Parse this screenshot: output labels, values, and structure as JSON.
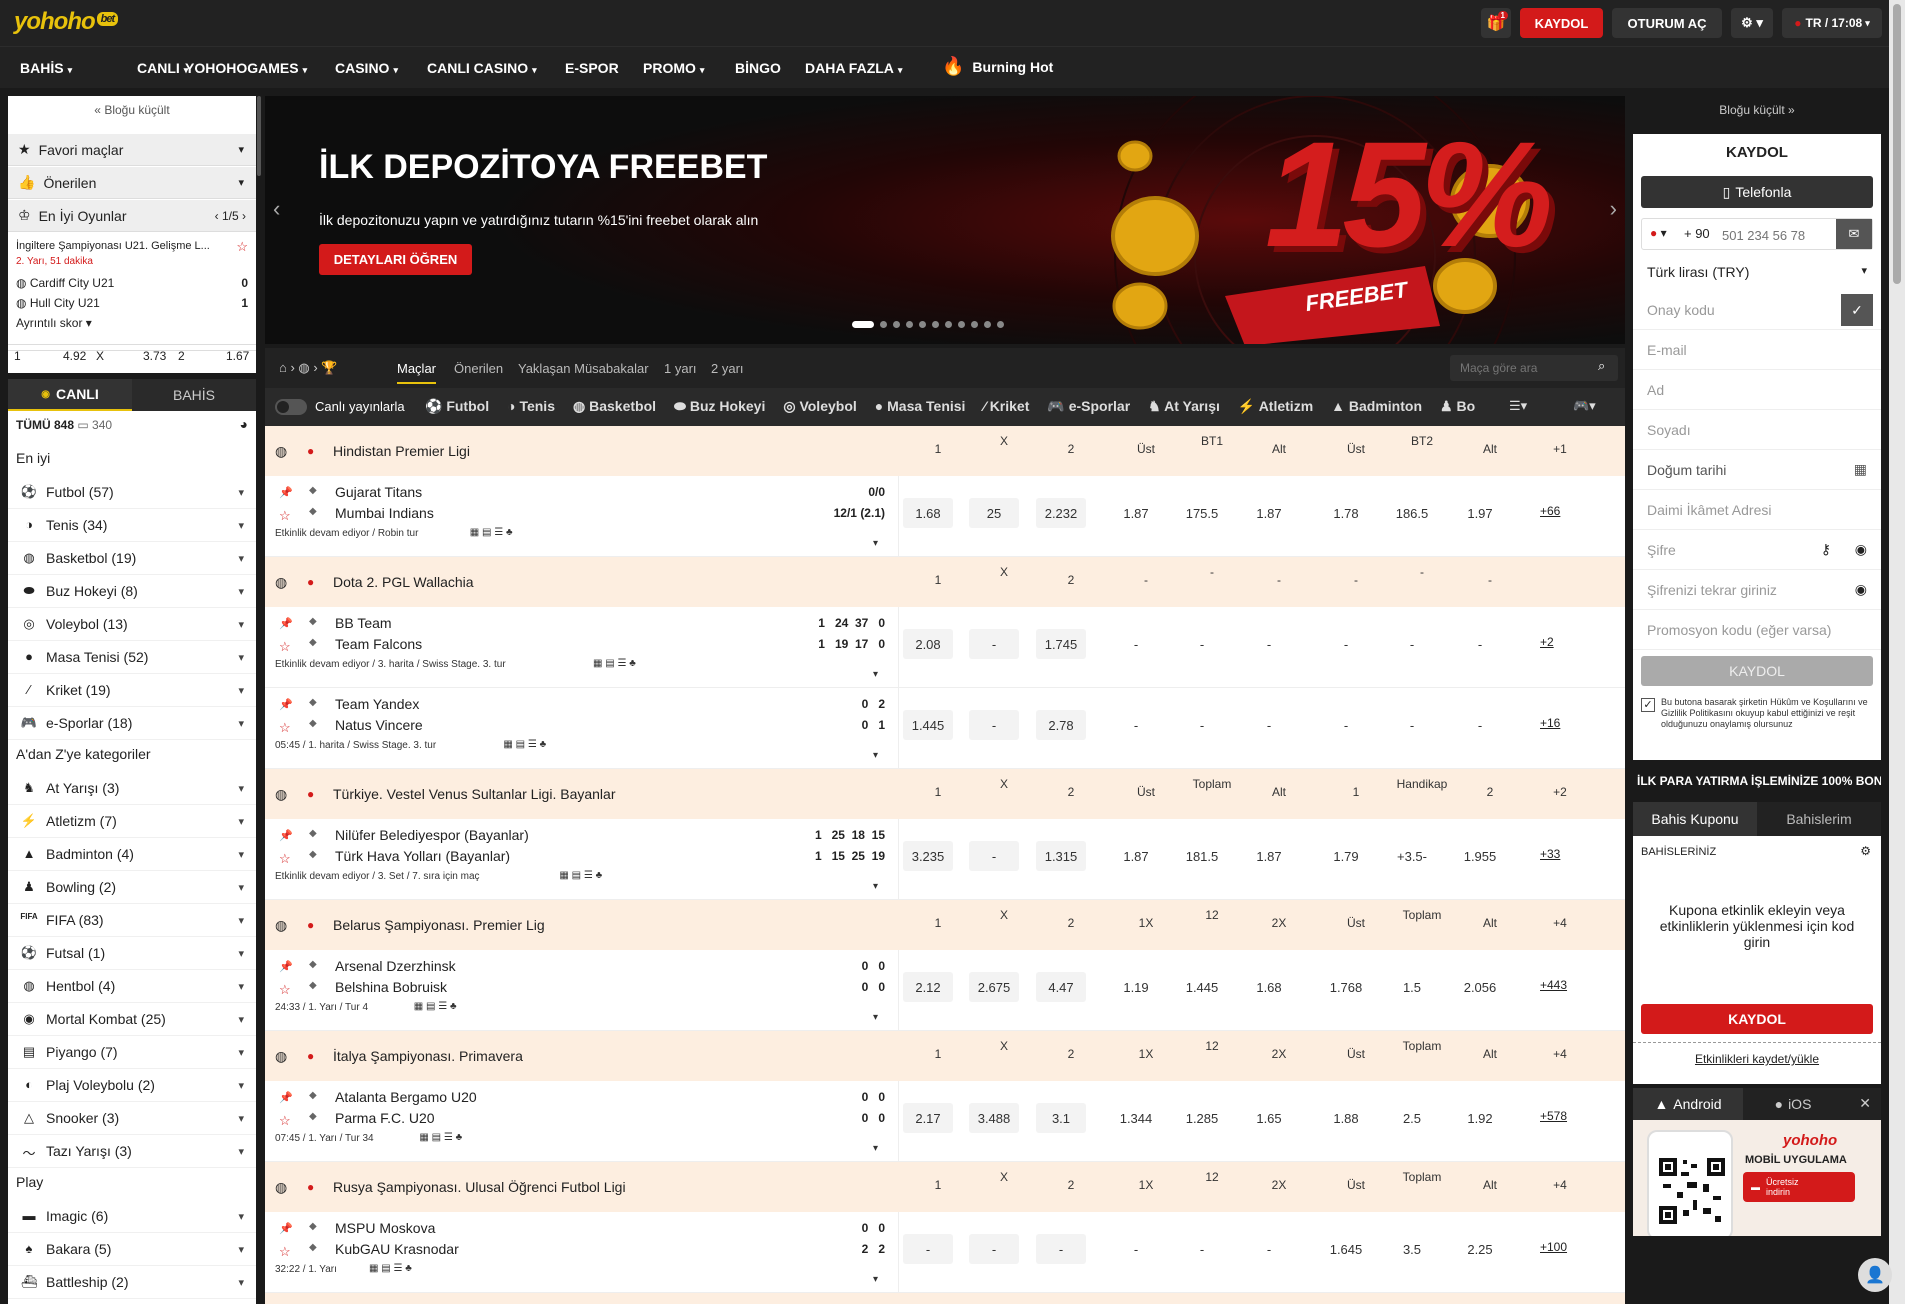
{
  "header": {
    "logo": "yohoho",
    "logo_badge": "bet",
    "gift_count": "1",
    "register": "KAYDOL",
    "login": "OTURUM AÇ",
    "lang_time": "TR / 17:08"
  },
  "nav": [
    "BAHİS",
    "CANLI",
    "YOHOHOGAMES",
    "CASINO",
    "CANLI CASINO",
    "E-SPOR",
    "PROMO",
    "BİNGO",
    "DAHA FAZLA"
  ],
  "nav_special": "Burning Hot",
  "left": {
    "collapse": "Bloğu küçült",
    "favorites": "Favori maçlar",
    "recommended": "Önerilen",
    "top_games": "En İyi Oyunlar",
    "top_pager": "1/5",
    "top_match": {
      "league": "İngiltere Şampiyonası U21. Gelişme L...",
      "status": "2. Yarı, 51 dakika",
      "team1": "Cardiff City U21",
      "score1": "0",
      "team2": "Hull City U21",
      "score2": "1",
      "detail": "Ayrıntılı skor",
      "odds": [
        "1",
        "4.92",
        "X",
        "3.73",
        "2",
        "1.67"
      ]
    },
    "tab_live": "CANLI",
    "tab_bet": "BAHİS",
    "all_label": "TÜMÜ 848",
    "all_count": "340",
    "best": "En iyi",
    "sports": [
      "Futbol (57)",
      "Tenis (34)",
      "Basketbol (19)",
      "Buz Hokeyi (8)",
      "Voleybol (13)",
      "Masa Tenisi (52)",
      "Kriket (19)",
      "e-Sporlar (18)"
    ],
    "az": "A'dan Z'ye kategoriler",
    "az_items": [
      "At Yarışı (3)",
      "Atletizm (7)",
      "Badminton (4)",
      "Bowling (2)",
      "FIFA (83)",
      "Futsal (1)",
      "Hentbol (4)",
      "Mortal Kombat (25)",
      "Piyango (7)",
      "Plaj Voleybolu (2)",
      "Snooker (3)",
      "Tazı Yarışı (3)"
    ],
    "play": "Play",
    "play_items": [
      "Imagic (6)",
      "Bakara (5)",
      "Battleship (2)"
    ]
  },
  "banner": {
    "title": "İLK DEPOZİTOYA FREEBET",
    "subtitle": "İlk depozitonuzu yapın ve yatırdığınız tutarın %15'ini freebet olarak alın",
    "cta": "DETAYLARI ÖĞREN",
    "big": "15%",
    "ribbon": "FREEBET"
  },
  "tabs": [
    "Maçlar",
    "Önerilen",
    "Yaklaşan Müsabakalar",
    "1 yarı",
    "2 yarı"
  ],
  "search_placeholder": "Maça göre ara",
  "live_toggle": "Canlı yayınlarla",
  "sport_tabs": [
    "Futbol",
    "Tenis",
    "Basketbol",
    "Buz Hokeyi",
    "Voleybol",
    "Masa Tenisi",
    "Kriket",
    "e-Sporlar",
    "At Yarışı",
    "Atletizm",
    "Badminton",
    "Bo"
  ],
  "leagues": [
    {
      "name": "Hindistan Premier Ligi",
      "h": [
        "1",
        "X",
        "2",
        "Üst",
        "BT1",
        "Alt",
        "Üst",
        "BT2",
        "Alt",
        "+1"
      ],
      "events": [
        {
          "t1": "Gujarat Titans",
          "t2": "Mumbai Indians",
          "s1": "0/0",
          "s2": "12/1 (2.1)",
          "info": "Etkinlik devam ediyor / Robin tur",
          "odds": [
            "1.68",
            "25",
            "2.232",
            "1.87",
            "175.5",
            "1.87",
            "1.78",
            "186.5",
            "1.97"
          ],
          "more": "+66"
        }
      ]
    },
    {
      "name": "Dota 2. PGL Wallachia",
      "h": [
        "1",
        "X",
        "2",
        "-",
        "-",
        "-",
        "-",
        "-",
        "-",
        ""
      ],
      "events": [
        {
          "t1": "BB Team",
          "t2": "Team Falcons",
          "s1": "1   24  37   0",
          "s2": "1   19  17   0",
          "info": "Etkinlik devam ediyor / 3. harita / Swiss Stage. 3. tur",
          "odds": [
            "2.08",
            "-",
            "1.745",
            "-",
            "-",
            "-",
            "-",
            "-",
            "-"
          ],
          "more": "+2"
        },
        {
          "t1": "Team Yandex",
          "t2": "Natus Vincere",
          "s1": "0   2",
          "s2": "0   1",
          "info": "05:45 / 1. harita / Swiss Stage. 3. tur",
          "odds": [
            "1.445",
            "-",
            "2.78",
            "-",
            "-",
            "-",
            "-",
            "-",
            "-"
          ],
          "more": "+16"
        }
      ]
    },
    {
      "name": "Türkiye. Vestel Venus Sultanlar Ligi. Bayanlar",
      "h": [
        "1",
        "X",
        "2",
        "Üst",
        "Toplam",
        "Alt",
        "1",
        "Handikap",
        "2",
        "+2"
      ],
      "events": [
        {
          "t1": "Nilüfer Belediyespor (Bayanlar)",
          "t2": "Türk Hava Yolları (Bayanlar)",
          "s1": "1   25  18  15",
          "s2": "1   15  25  19",
          "info": "Etkinlik devam ediyor / 3. Set / 7. sıra için maç",
          "odds": [
            "3.235",
            "-",
            "1.315",
            "1.87",
            "181.5",
            "1.87",
            "1.79",
            "+3.5-",
            "1.955"
          ],
          "more": "+33"
        }
      ]
    },
    {
      "name": "Belarus Şampiyonası. Premier Lig",
      "h": [
        "1",
        "X",
        "2",
        "1X",
        "12",
        "2X",
        "Üst",
        "Toplam",
        "Alt",
        "+4"
      ],
      "events": [
        {
          "t1": "Arsenal Dzerzhinsk",
          "t2": "Belshina Bobruisk",
          "s1": "0   0",
          "s2": "0   0",
          "info": "24:33 / 1. Yarı / Tur 4",
          "odds": [
            "2.12",
            "2.675",
            "4.47",
            "1.19",
            "1.445",
            "1.68",
            "1.768",
            "1.5",
            "2.056"
          ],
          "more": "+443"
        }
      ]
    },
    {
      "name": "İtalya Şampiyonası. Primavera",
      "h": [
        "1",
        "X",
        "2",
        "1X",
        "12",
        "2X",
        "Üst",
        "Toplam",
        "Alt",
        "+4"
      ],
      "events": [
        {
          "t1": "Atalanta Bergamo U20",
          "t2": "Parma F.C. U20",
          "s1": "0   0",
          "s2": "0   0",
          "info": "07:45 / 1. Yarı / Tur 34",
          "odds": [
            "2.17",
            "3.488",
            "3.1",
            "1.344",
            "1.285",
            "1.65",
            "1.88",
            "2.5",
            "1.92"
          ],
          "more": "+578"
        }
      ]
    },
    {
      "name": "Rusya Şampiyonası. Ulusal Öğrenci Futbol Ligi",
      "h": [
        "1",
        "X",
        "2",
        "1X",
        "12",
        "2X",
        "Üst",
        "Toplam",
        "Alt",
        "+4"
      ],
      "events": [
        {
          "t1": "MSPU Moskova",
          "t2": "KubGAU Krasnodar",
          "s1": "0   0",
          "s2": "2   2",
          "info": "32:22 / 1. Yarı",
          "odds": [
            "-",
            "-",
            "-",
            "-",
            "-",
            "-",
            "1.645",
            "3.5",
            "2.25"
          ],
          "more": "+100"
        }
      ]
    }
  ],
  "right": {
    "collapse": "Bloğu küçült",
    "title": "KAYDOL",
    "phone_tab": "Telefonla",
    "phone_code": "+ 90",
    "phone_placeholder": "501 234 56 78",
    "currency": "Türk lirası (TRY)",
    "fields": [
      "Onay kodu",
      "E-mail",
      "Ad",
      "Soyadı",
      "Doğum tarihi",
      "Daimi İkâmet Adresi",
      "Şifre",
      "Şifrenizi tekrar giriniz",
      "Promosyon kodu (eğer varsa)"
    ],
    "submit": "KAYDOL",
    "terms": "Bu butona basarak şirketin Hükûm ve Koşullarını ve Gizlilik Politikasını okuyup kabul ettiğinizi ve reşit olduğunuzu onaylamış olursunuz",
    "promo": "İLK PARA YATIRMA İŞLEMİNİZE 100% BON...",
    "coupon_tab": "Bahis Kuponu",
    "bets_tab": "Bahislerim",
    "your_bets": "BAHİSLERİNİZ",
    "empty": "Kupona etkinlik ekleyin veya etkinliklerin yüklenmesi için kod girin",
    "register2": "KAYDOL",
    "save_load": "Etkinlikleri kaydet/yükle",
    "android": "Android",
    "ios": "iOS",
    "app_logo": "yohoho",
    "app_title": "MOBİL UYGULAMA",
    "app_free": "Ücretsiz indirin"
  },
  "colors": {
    "red": "#d31a1a",
    "dark": "#222222",
    "peach": "#fdeee0",
    "yellow": "#e8c20c"
  }
}
